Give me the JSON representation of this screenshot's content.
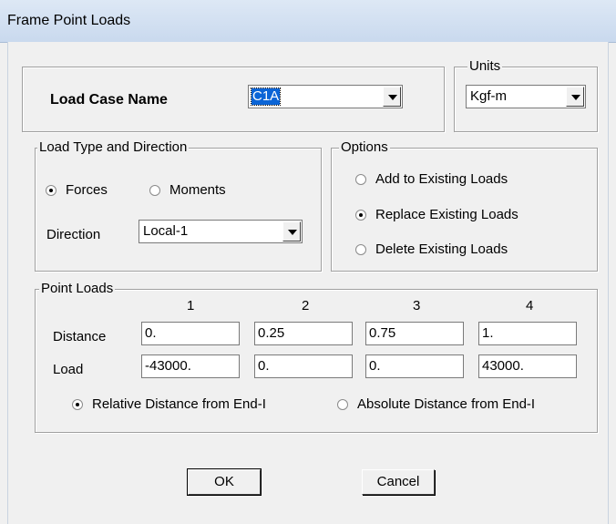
{
  "window": {
    "title": "Frame Point Loads"
  },
  "load_case": {
    "label": "Load Case Name",
    "value": "C1A"
  },
  "units": {
    "legend": "Units",
    "value": "Kgf-m"
  },
  "load_type": {
    "legend": "Load Type and Direction",
    "forces_label": "Forces",
    "moments_label": "Moments",
    "selected": "Forces",
    "direction_label": "Direction",
    "direction_value": "Local-1"
  },
  "options": {
    "legend": "Options",
    "items": [
      "Add to Existing Loads",
      "Replace Existing Loads",
      "Delete Existing Loads"
    ],
    "selected": "Replace Existing Loads"
  },
  "point_loads": {
    "legend": "Point Loads",
    "columns": [
      "1",
      "2",
      "3",
      "4"
    ],
    "distance_label": "Distance",
    "load_label": "Load",
    "distances": [
      "0.",
      "0.25",
      "0.75",
      "1."
    ],
    "loads": [
      "-43000.",
      "0.",
      "0.",
      "43000."
    ],
    "relative_label": "Relative Distance from End-I",
    "absolute_label": "Absolute Distance from End-I",
    "selected": "Relative Distance from End-I"
  },
  "buttons": {
    "ok": "OK",
    "cancel": "Cancel"
  }
}
